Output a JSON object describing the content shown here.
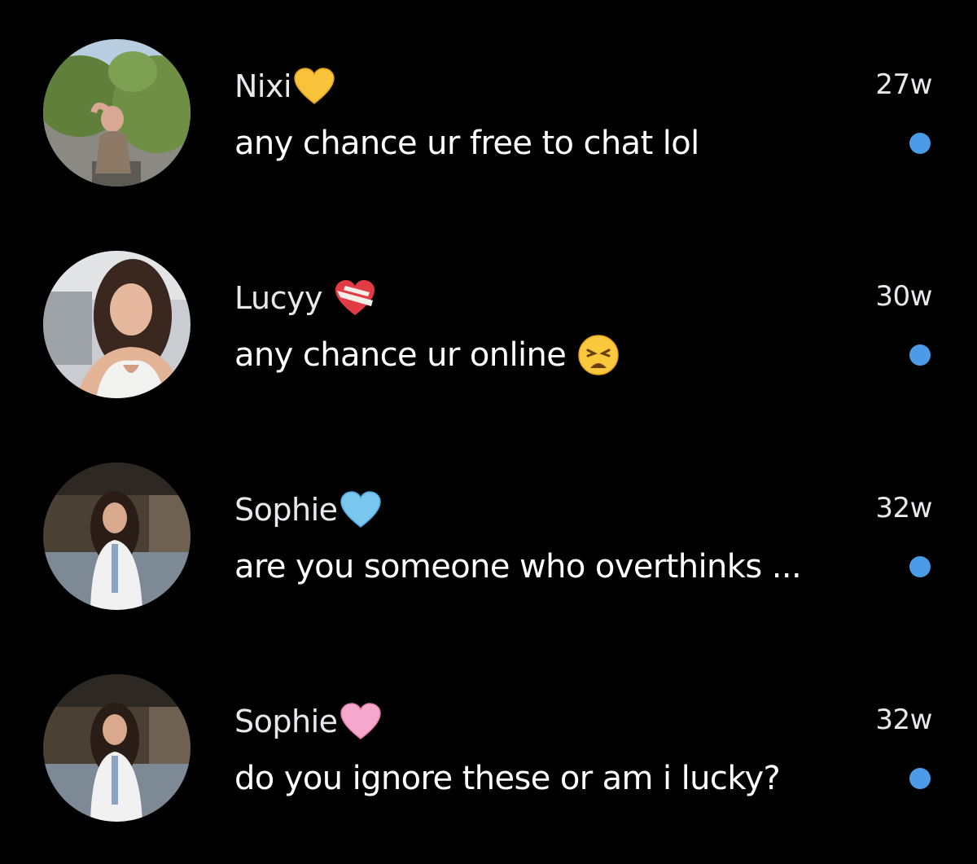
{
  "colors": {
    "background": "#000000",
    "name_text": "#e7e9ea",
    "preview_text": "#ffffff",
    "unread_dot": "#4b9be8"
  },
  "conversations": [
    {
      "name": "Nixi",
      "name_emoji": "yellow-heart-icon",
      "time": "27w",
      "preview": "any chance ur free to chat lol",
      "preview_emoji": "",
      "unread": true
    },
    {
      "name": "Lucyy",
      "name_emoji": "mending-heart-icon",
      "time": "30w",
      "preview": "any chance ur online",
      "preview_emoji": "weary-face-icon",
      "unread": true
    },
    {
      "name": "Sophie",
      "name_emoji": "light-blue-heart-icon",
      "time": "32w",
      "preview": "are you someone who overthinks ...",
      "preview_emoji": "",
      "unread": true
    },
    {
      "name": "Sophie",
      "name_emoji": "pink-heart-icon",
      "time": "32w",
      "preview": "do you ignore these or am i lucky?",
      "preview_emoji": "",
      "unread": true
    }
  ]
}
